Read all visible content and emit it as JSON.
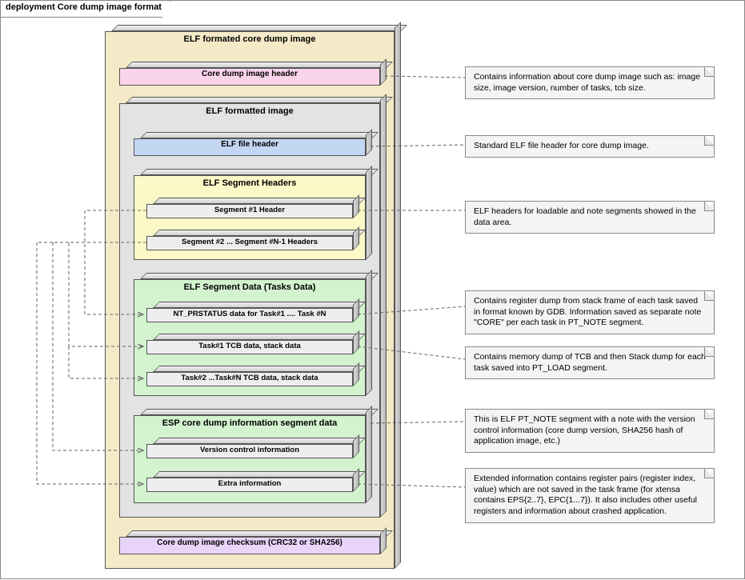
{
  "frame_title": "deployment Core dump image format",
  "outer_box": "ELF formated core dump image",
  "header_box": "Core dump image header",
  "elf_image_box": "ELF formatted image",
  "elf_file_header": "ELF file header",
  "seg_hdr_box": "ELF Segment Headers",
  "seg_hdr_1": "Segment #1 Header",
  "seg_hdr_rest": "Segment #2 ... Segment #N-1 Headers",
  "seg_data_box": "ELF Segment Data (Tasks Data)",
  "nt_prstatus": "NT_PRSTATUS data for Task#1 .... Task #N",
  "task1_data": "Task#1 TCB data, stack data",
  "taskn_data": "Task#2 ...Task#N TCB data,  stack data",
  "esp_info_box": "ESP core dump information segment data",
  "vcinfo": "Version control information",
  "extra_info": "Extra information",
  "checksum_box": "Core dump image checksum (CRC32 or SHA256)",
  "note_header": "Contains information about core dump image such as: image size, image version, number of tasks, tcb size.",
  "note_elfhdr": "Standard ELF file header for core dump image.",
  "note_seghdr": "ELF headers for loadable and note segments showed in the data area.",
  "note_prstat": "Contains register dump from stack frame of each task saved in format known by GDB. Information saved as separate note \"CORE\" per each task in PT_NOTE segment.",
  "note_tcb": "Contains memory dump of TCB and then Stack dump for each task saved into PT_LOAD segment.",
  "note_vcinfo": "This is ELF PT_NOTE segment with a note with the version control information (core dump version, SHA256 hash of application image, etc.)",
  "note_extra": "Extended information contains register pairs (register index, value) which are not saved in the task frame (for xtensa contains EPS{2..7}, EPC{1...7}). It also includes other useful registers and information about crashed application."
}
